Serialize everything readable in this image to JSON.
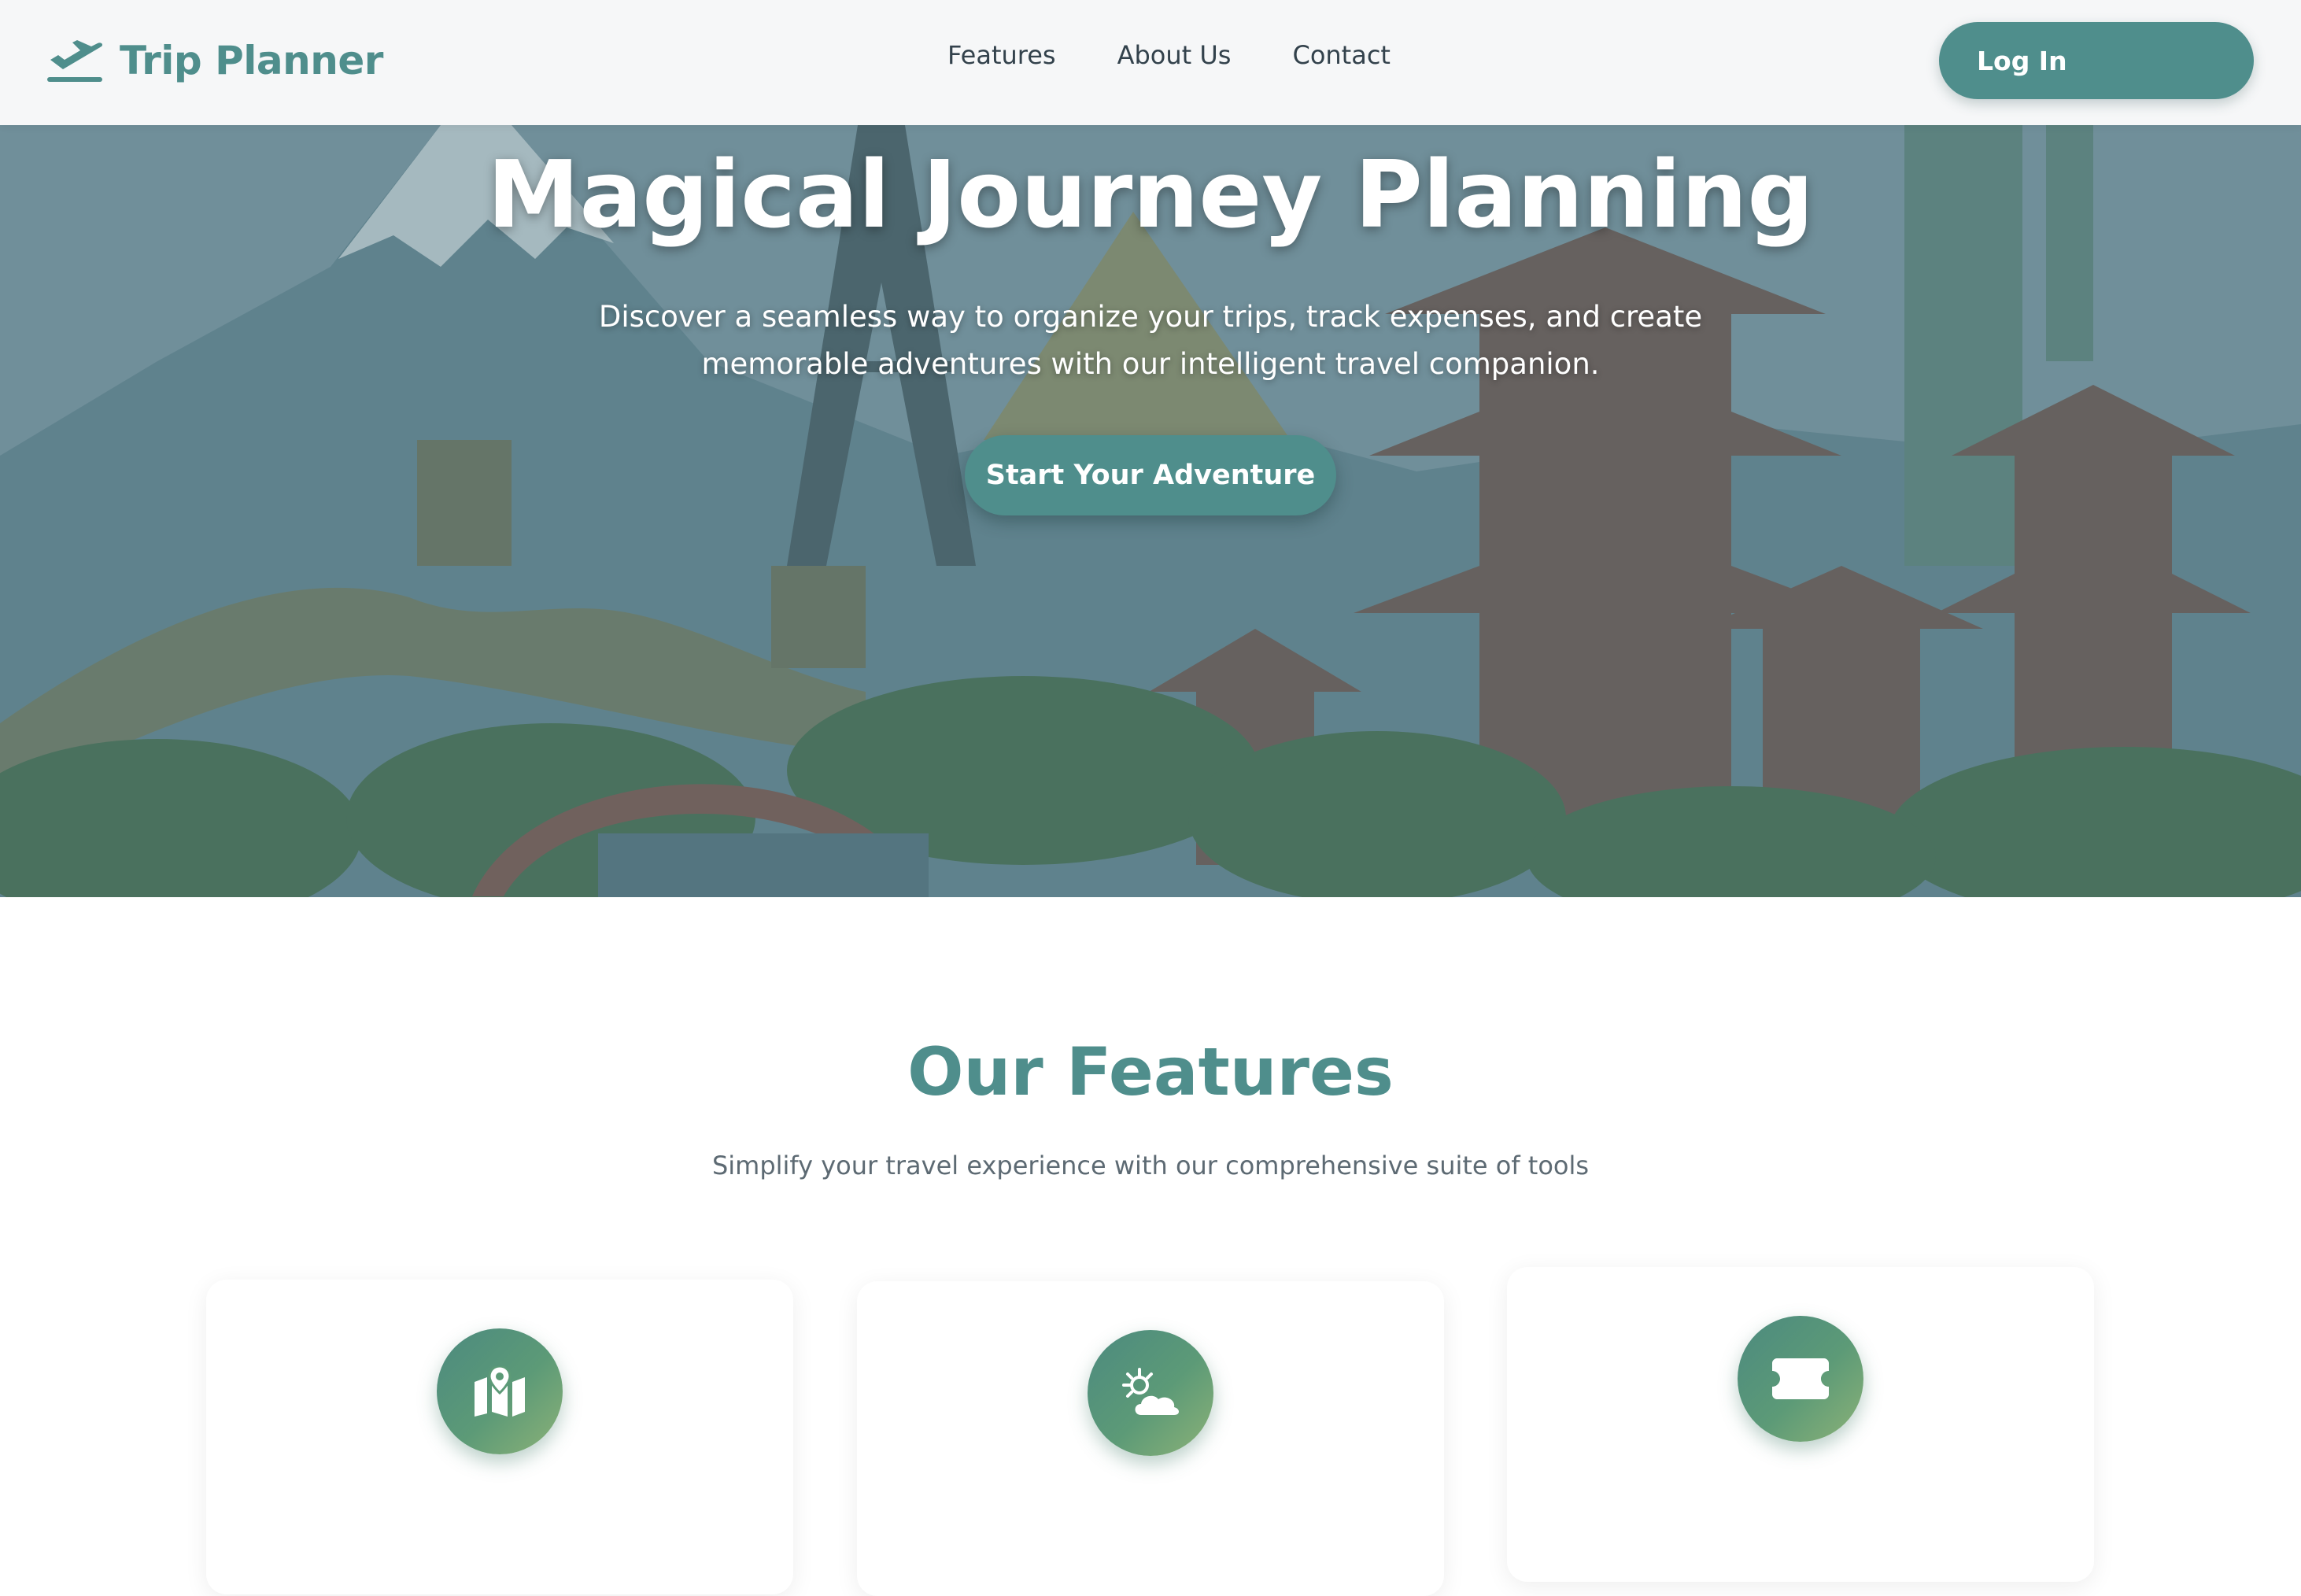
{
  "header": {
    "brand_name": "Trip Planner",
    "brand_icon": "plane-departure-icon",
    "nav": [
      "Features",
      "About Us",
      "Contact"
    ],
    "login_label": "Log In"
  },
  "hero": {
    "title": "Magical Journey Planning",
    "subtitle": "Discover a seamless way to organize your trips, track expenses, and create memorable adventures with our intelligent travel companion.",
    "cta_label": "Start Your Adventure"
  },
  "features": {
    "title": "Our Features",
    "subtitle": "Simplify your travel experience with our comprehensive suite of tools",
    "cards": [
      {
        "icon": "map-location-icon"
      },
      {
        "icon": "weather-sun-cloud-icon"
      },
      {
        "icon": "ticket-icon"
      }
    ]
  },
  "colors": {
    "accent": "#4f8e8c",
    "header_bg": "#f6f7f8",
    "text_dark": "#33424c",
    "text_muted": "#5d6a73"
  }
}
